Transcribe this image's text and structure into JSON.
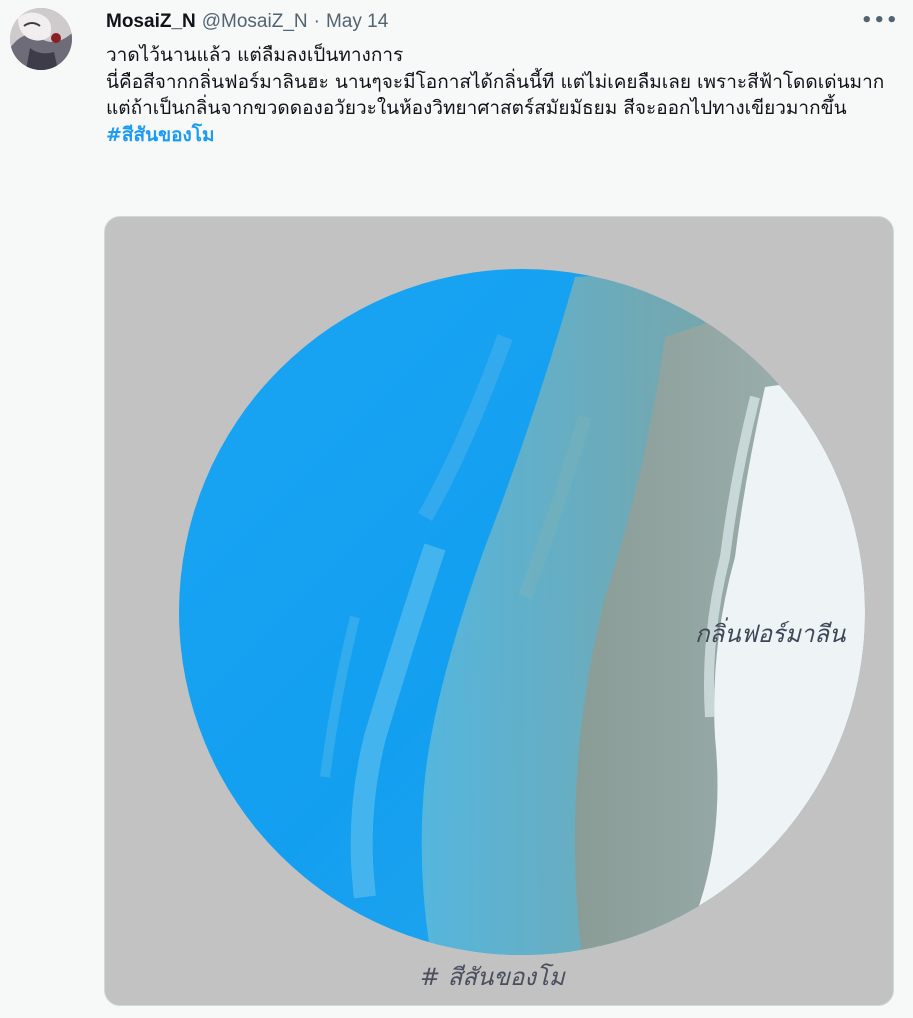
{
  "tweet": {
    "author": {
      "display_name": "MosaiZ_N",
      "handle": "@MosaiZ_N",
      "avatar_icon": "avatar-illustration"
    },
    "separator": "·",
    "date": "May 14",
    "more_icon": "•••",
    "text_lines": [
      "วาดไว้นานแล้ว แต่ลืมลงเป็นทางการ",
      "นี่คือสีจากกลิ่นฟอร์มาลินฮะ นานๆจะมีโอกาสได้กลิ่นนี้ที แต่ไม่เคยลืมเลย เพราะสีฟ้าโดดเด่นมาก แต่ถ้าเป็นกลิ่นจากขวดดองอวัยวะในห้องวิทยาศาสตร์สมัยมัธยม สีจะออกไปทางเขียวมากขึ้น"
    ],
    "hashtag": "#สีสันของโม",
    "media": {
      "handwritten_label": "กลิ่นฟอร์มาลีน",
      "handwritten_hashtag": "# สีสันของโม",
      "colors": {
        "background": "#c2c2c2",
        "blue": "#12a0f2",
        "teal": "#6fa9b0",
        "gray_green": "#8b9a96",
        "white": "#eef3f5"
      }
    }
  }
}
